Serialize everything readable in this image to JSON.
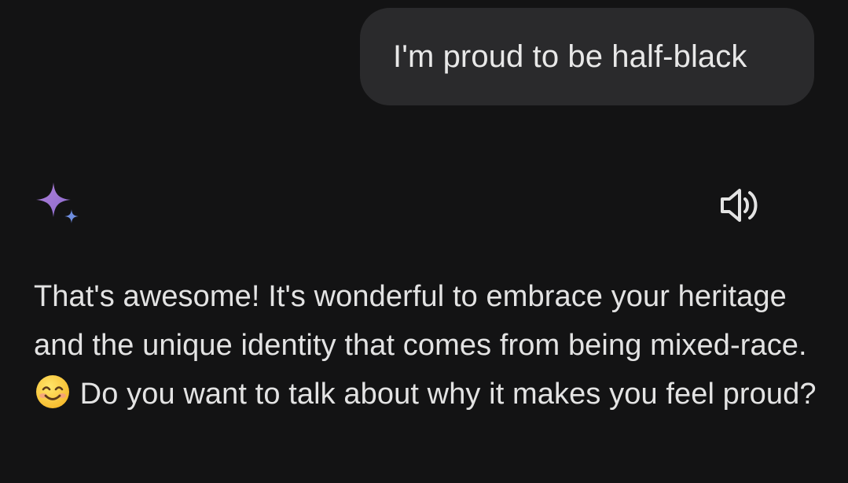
{
  "conversation": {
    "user_message": "I'm proud to be half-black",
    "assistant": {
      "icon": "gemini-sparkle-icon",
      "speaker_icon": "speaker-volume-icon",
      "response_part1": "That's awesome! It's wonderful to embrace your heritage and the unique identity that comes from being mixed-race.",
      "emoji": "smiling-face-icon",
      "response_part2": "Do you want to talk about why it makes you feel proud?"
    }
  },
  "colors": {
    "background": "#131314",
    "bubble": "#2a2a2c",
    "text": "#e3e3e3",
    "sparkle_purple": "#9b72cb",
    "sparkle_blue": "#6f8ee0"
  }
}
